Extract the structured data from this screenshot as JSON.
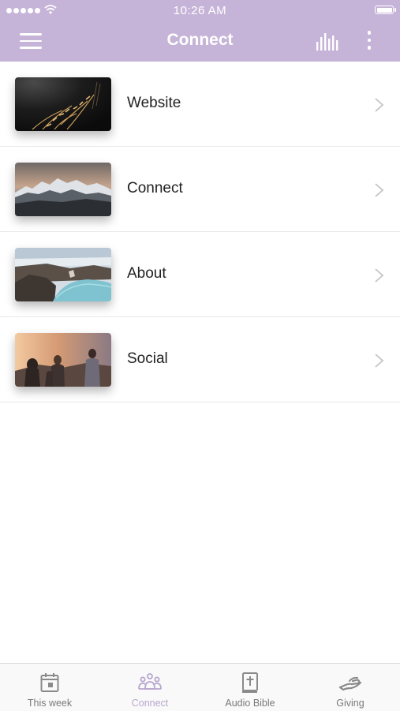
{
  "status_bar": {
    "time": "10:26 AM"
  },
  "header": {
    "title": "Connect"
  },
  "list": {
    "items": [
      {
        "label": "Website"
      },
      {
        "label": "Connect"
      },
      {
        "label": "About"
      },
      {
        "label": "Social"
      }
    ]
  },
  "tabbar": {
    "tabs": [
      {
        "label": "This week",
        "icon": "calendar-icon"
      },
      {
        "label": "Connect",
        "icon": "people-icon",
        "active": true
      },
      {
        "label": "Audio Bible",
        "icon": "bible-icon"
      },
      {
        "label": "Giving",
        "icon": "hand-icon"
      }
    ]
  },
  "colors": {
    "header": "#c6b4d8",
    "active_tab": "#b8a6cf",
    "inactive_tab": "#7a7a7a",
    "divider": "#e9e9ee"
  }
}
